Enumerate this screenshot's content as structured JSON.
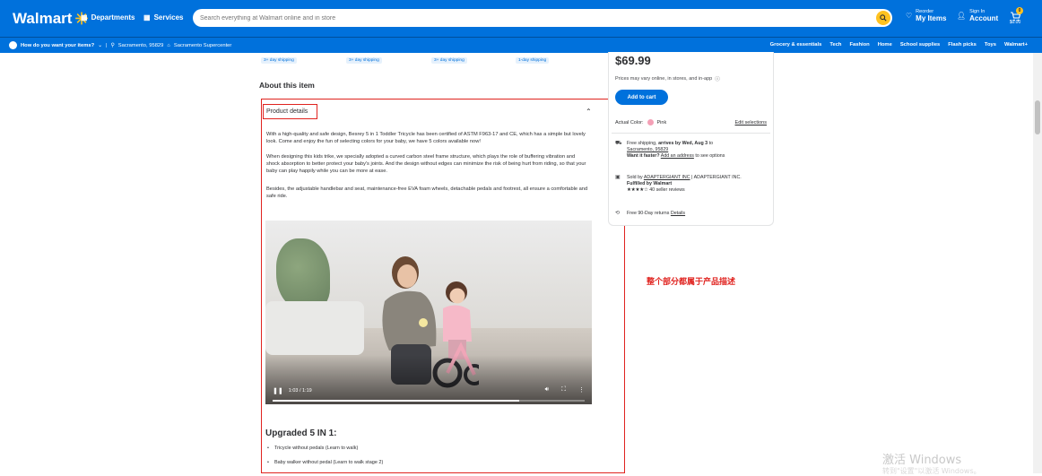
{
  "header": {
    "logo": "Walmart",
    "departments": "Departments",
    "services": "Services",
    "search_placeholder": "Search everything at Walmart online and in store",
    "reorder_small": "Reorder",
    "reorder_big": "My Items",
    "signin_small": "Sign In",
    "signin_big": "Account",
    "cart_count": "0",
    "cart_price": "$0.00"
  },
  "subbar": {
    "how_text": "How do you want your items?",
    "location": "Sacramento, 95829",
    "store": "Sacramento Supercenter",
    "nav": [
      "Grocery & essentials",
      "Tech",
      "Fashion",
      "Home",
      "School supplies",
      "Flash picks",
      "Toys",
      "Walmart+"
    ]
  },
  "shipping_tags": [
    "3+ day shipping",
    "3+ day shipping",
    "3+ day shipping",
    "1-day shipping"
  ],
  "about": {
    "title": "About this item",
    "product_details": "Product details",
    "paragraphs": [
      "With a high-quality and safe design, Besrey 5 in 1 Toddler Tricycle has been certified of ASTM F963-17 and CE, which has a simple but lovely look. Come and enjoy the fun of selecting colors for your baby, we have 5 colors available now!",
      "When designing this kids trike, we specially adopted a curved carbon steel frame structure, which plays the role of buffering vibration and shock absorption to better protect your baby's joints. And the design without edges can minimize the risk of being hurt from riding, so that your baby can play happily while you can be more at ease.",
      "Besides, the adjustable handlebar and seat, maintenance-free EVA foam wheels, detachable pedals and footrest, all ensure a comfortable and safe ride."
    ],
    "video_time": "1:03 / 1:19",
    "video_progress": 0.79,
    "upgraded_title": "Upgraded 5 IN 1:",
    "bullets": [
      "Tricycle without pedals (Learn to walk)",
      "Baby walker without pedal (Learn to walk stage 2)"
    ]
  },
  "annotation": "整个部分都属于产品描述",
  "buybox": {
    "price": "$69.99",
    "price_note": "Prices may vary online, in stores, and in-app",
    "add_to_cart": "Add to cart",
    "color_label": "Actual Color:",
    "color_value": "Pink",
    "color_hex": "#f4a0b6",
    "edit_selections": "Edit selections",
    "shipping_prefix": "Free shipping,",
    "shipping_arrives": "arrives by Wed, Aug 3",
    "shipping_to": "to",
    "shipping_loc": "Sacramento, 95829",
    "faster_bold": "Want it faster?",
    "faster_link": "Add an address",
    "faster_suffix": "to see options",
    "sold_by": "Sold by",
    "seller": "ADAPTERGIANT INC",
    "seller_alt": "ADAPTERGIANT INC.",
    "fulfilled": "Fulfilled by Walmart",
    "stars": "★★★★☆",
    "seller_reviews": "40 seller reviews",
    "returns": "Free 90-Day returns",
    "returns_link": "Details"
  },
  "watermark": {
    "line1": "激活 Windows",
    "line2": "转到\"设置\"以激活 Windows。"
  }
}
